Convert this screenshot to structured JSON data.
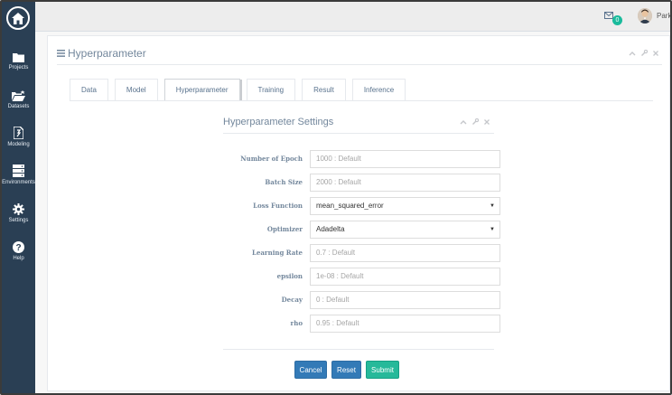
{
  "sidebar": {
    "items": [
      {
        "label": "Projects",
        "icon": "folder-icon"
      },
      {
        "label": "Datasets",
        "icon": "folder-open-icon"
      },
      {
        "label": "Modeling",
        "icon": "document-icon"
      },
      {
        "label": "Environments",
        "icon": "server-icon"
      },
      {
        "label": "Settings",
        "icon": "gear-icon"
      },
      {
        "label": "Help",
        "icon": "help-icon"
      }
    ]
  },
  "topbar": {
    "mail_badge": "0",
    "username": "Park"
  },
  "panel": {
    "title": "Hyperparameter"
  },
  "tabs": [
    {
      "label": "Data",
      "active": false
    },
    {
      "label": "Model",
      "active": false
    },
    {
      "label": "Hyperparameter",
      "active": true
    },
    {
      "label": "Training",
      "active": false
    },
    {
      "label": "Result",
      "active": false
    },
    {
      "label": "Inference",
      "active": false
    }
  ],
  "settings": {
    "title": "Hyperparameter Settings",
    "fields": [
      {
        "label": "Number of Epoch",
        "placeholder": "1000 : Default",
        "type": "input"
      },
      {
        "label": "Batch Size",
        "placeholder": "2000 : Default",
        "type": "input"
      },
      {
        "label": "Loss Function",
        "value": "mean_squared_error",
        "type": "select"
      },
      {
        "label": "Optimizer",
        "value": "Adadelta",
        "type": "select"
      },
      {
        "label": "Learning Rate",
        "placeholder": "0.7 : Default",
        "type": "input"
      },
      {
        "label": "epsilon",
        "placeholder": "1e-08 : Default",
        "type": "input"
      },
      {
        "label": "Decay",
        "placeholder": "0 : Default",
        "type": "input"
      },
      {
        "label": "rho",
        "placeholder": "0.95 : Default",
        "type": "input"
      }
    ]
  },
  "buttons": {
    "cancel": "Cancel",
    "reset": "Reset",
    "submit": "Submit"
  },
  "colors": {
    "sidebar": "#2a3f54",
    "primary": "#337ab7",
    "success": "#26b99a",
    "badge": "#1abb9c"
  }
}
